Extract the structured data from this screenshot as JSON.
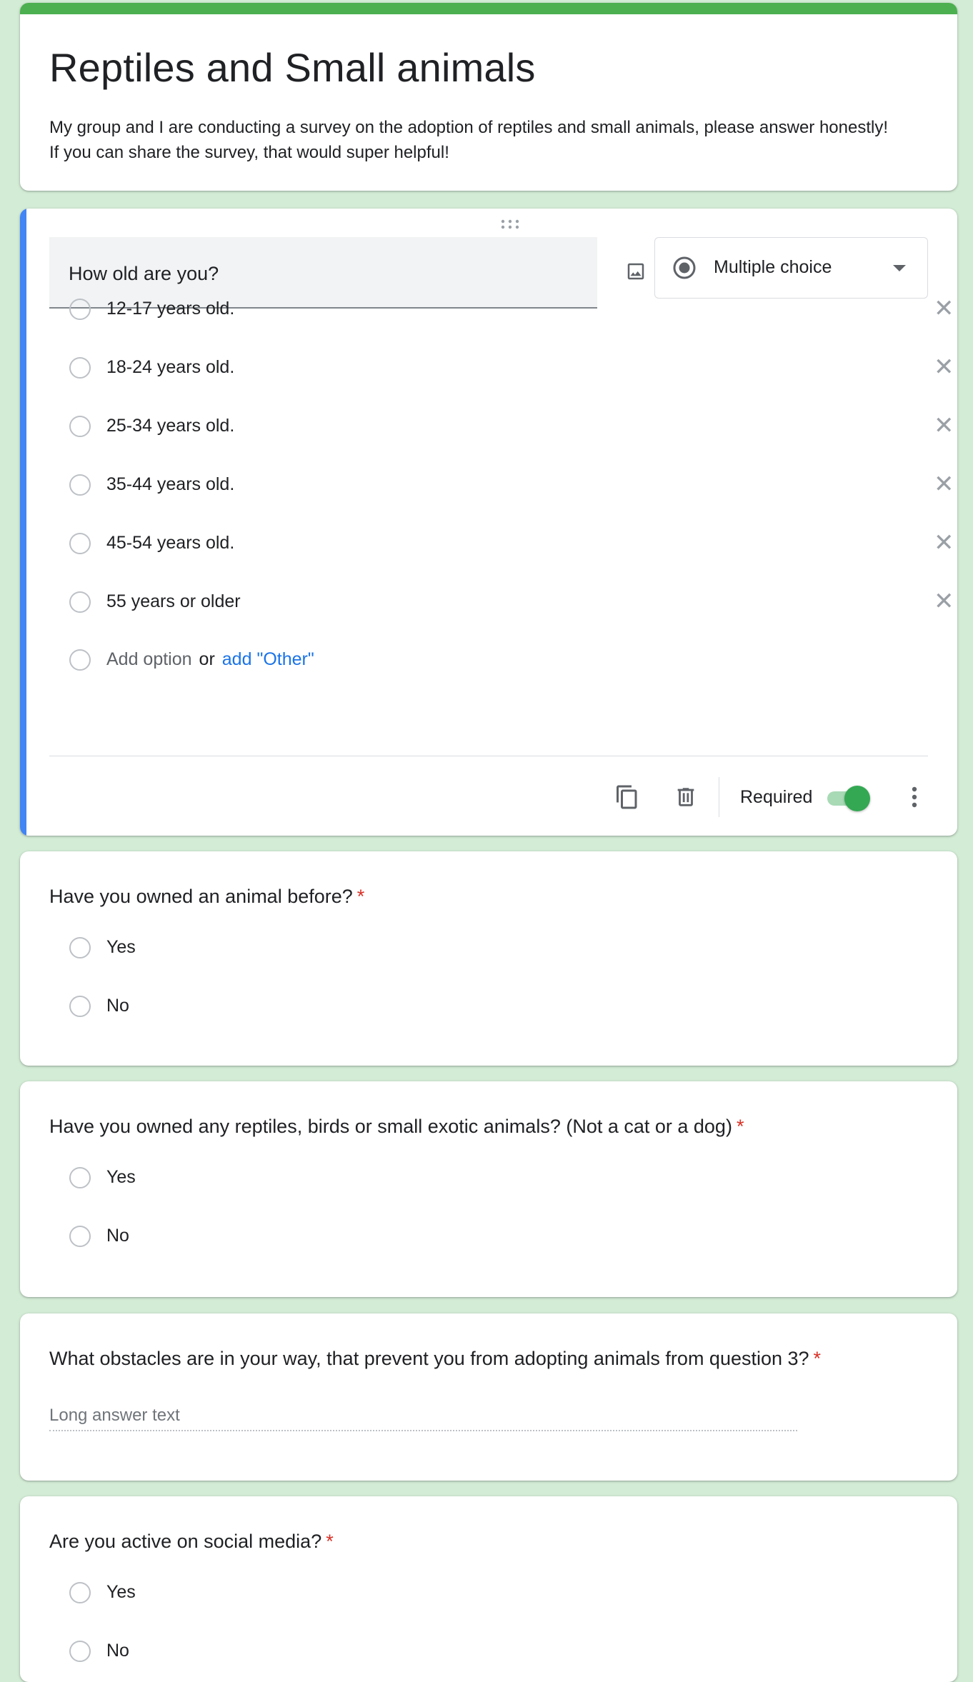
{
  "form": {
    "title": "Reptiles and Small animals",
    "description_line1": "My group and I are conducting a survey on the adoption of reptiles and small animals, please answer honestly!",
    "description_line2": "If you can share the survey, that would super helpful!",
    "accent_color": "#4caf50",
    "background_color": "#d3ecd5"
  },
  "active_question": {
    "title": "How old are you?",
    "type": "Multiple choice",
    "options": [
      "12-17 years old.",
      "18-24 years old.",
      "25-34 years old.",
      "35-44 years old.",
      "45-54 years old.",
      "55 years or older"
    ],
    "add_option": "Add option",
    "or": "or",
    "add_other": "add \"Other\"",
    "required_label": "Required",
    "required": true,
    "icons": [
      "drag-handle-icon",
      "image-icon",
      "radio-icon",
      "dropdown-caret-icon",
      "close-icon",
      "duplicate-icon",
      "delete-icon",
      "more-vert-icon"
    ]
  },
  "questions": [
    {
      "title": "Have you owned an animal before?",
      "required_mark": "*",
      "options": [
        "Yes",
        "No"
      ]
    },
    {
      "title": "Have you owned any reptiles, birds or small exotic animals? (Not a cat or a dog)",
      "required_mark": "*",
      "options": [
        "Yes",
        "No"
      ]
    },
    {
      "title": "What obstacles are in your way, that prevent you from adopting animals from question 3?",
      "required_mark": "*",
      "long_answer_placeholder": "Long answer text"
    },
    {
      "title": "Are you active on social media?",
      "required_mark": "*",
      "options": [
        "Yes",
        "No"
      ]
    }
  ]
}
